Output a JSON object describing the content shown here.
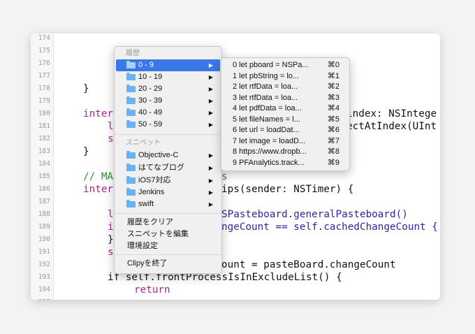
{
  "editor": {
    "lines": [
      {
        "n": "174",
        "t": ""
      },
      {
        "n": "175",
        "t": ""
      },
      {
        "n": "176",
        "t": ""
      },
      {
        "n": "177",
        "t": ""
      },
      {
        "n": "178",
        "t": "}"
      },
      {
        "n": "179",
        "t": ""
      },
      {
        "n": "180",
        "t": "inter"
      },
      {
        "n": "181",
        "t": "l"
      },
      {
        "n": "182",
        "t": "s"
      },
      {
        "n": "183",
        "t": "}"
      },
      {
        "n": "184",
        "t": ""
      },
      {
        "n": "185",
        "t": "// MA"
      },
      {
        "n": "186",
        "t": "inter"
      },
      {
        "n": "187",
        "t": ""
      },
      {
        "n": "188",
        "t": "l"
      },
      {
        "n": "189",
        "t": "i"
      },
      {
        "n": "190",
        "t": "}"
      },
      {
        "n": "191",
        "t": "s"
      },
      {
        "n": "192",
        "t": ""
      },
      {
        "n": "193",
        "t": ""
      },
      {
        "n": "194",
        "t": "if self.frontProcessIsInExcludeList() {"
      },
      {
        "n": "195",
        "t": "return"
      }
    ],
    "right_fragments": {
      "l180": "index: NSIntege",
      "l181": "ectAtIndex(UInt",
      "l185": "s",
      "l186": "ips(sender: NSTimer) {",
      "l188": "SPasteboard.generalPasteboard()",
      "l189": "ngeCount == self.cachedChangeCount {",
      "l191": "ount = pasteBoard.changeCount"
    }
  },
  "menu": {
    "history_header": "履歴",
    "history_items": [
      {
        "label": "0 - 9",
        "selected": true
      },
      {
        "label": "10 - 19"
      },
      {
        "label": "20 - 29"
      },
      {
        "label": "30 - 39"
      },
      {
        "label": "40 - 49"
      },
      {
        "label": "50 - 59"
      }
    ],
    "snippet_header": "スニペット",
    "snippet_items": [
      {
        "label": "Objective-C"
      },
      {
        "label": "はてなブログ"
      },
      {
        "label": "iOS7対応"
      },
      {
        "label": "Jenkins"
      },
      {
        "label": "swift"
      }
    ],
    "actions": [
      "履歴をクリア",
      "スニペットを編集",
      "環境設定"
    ],
    "quit": "Clipyを終了"
  },
  "submenu": {
    "items": [
      {
        "label": "0 let pboard = NSPa...",
        "shortcut": "⌘0"
      },
      {
        "label": "1 let pbString = lo...",
        "shortcut": "⌘1"
      },
      {
        "label": "2 let rtfData = loa...",
        "shortcut": "⌘2"
      },
      {
        "label": "3 let rtfData = loa...",
        "shortcut": "⌘3"
      },
      {
        "label": "4 let pdfData = loa...",
        "shortcut": "⌘4"
      },
      {
        "label": "5 let fileNames = l...",
        "shortcut": "⌘5"
      },
      {
        "label": "6 let url = loadDat...",
        "shortcut": "⌘6"
      },
      {
        "label": "7 let image = loadD...",
        "shortcut": "⌘7"
      },
      {
        "label": "8 https://www.dropb...",
        "shortcut": "⌘8"
      },
      {
        "label": "9 PFAnalytics.track...",
        "shortcut": "⌘9"
      }
    ]
  },
  "colors": {
    "selection": "#3b78e7",
    "folder": "#69b3f2",
    "keyword": "#a3288f",
    "comment": "#2f8f33"
  }
}
